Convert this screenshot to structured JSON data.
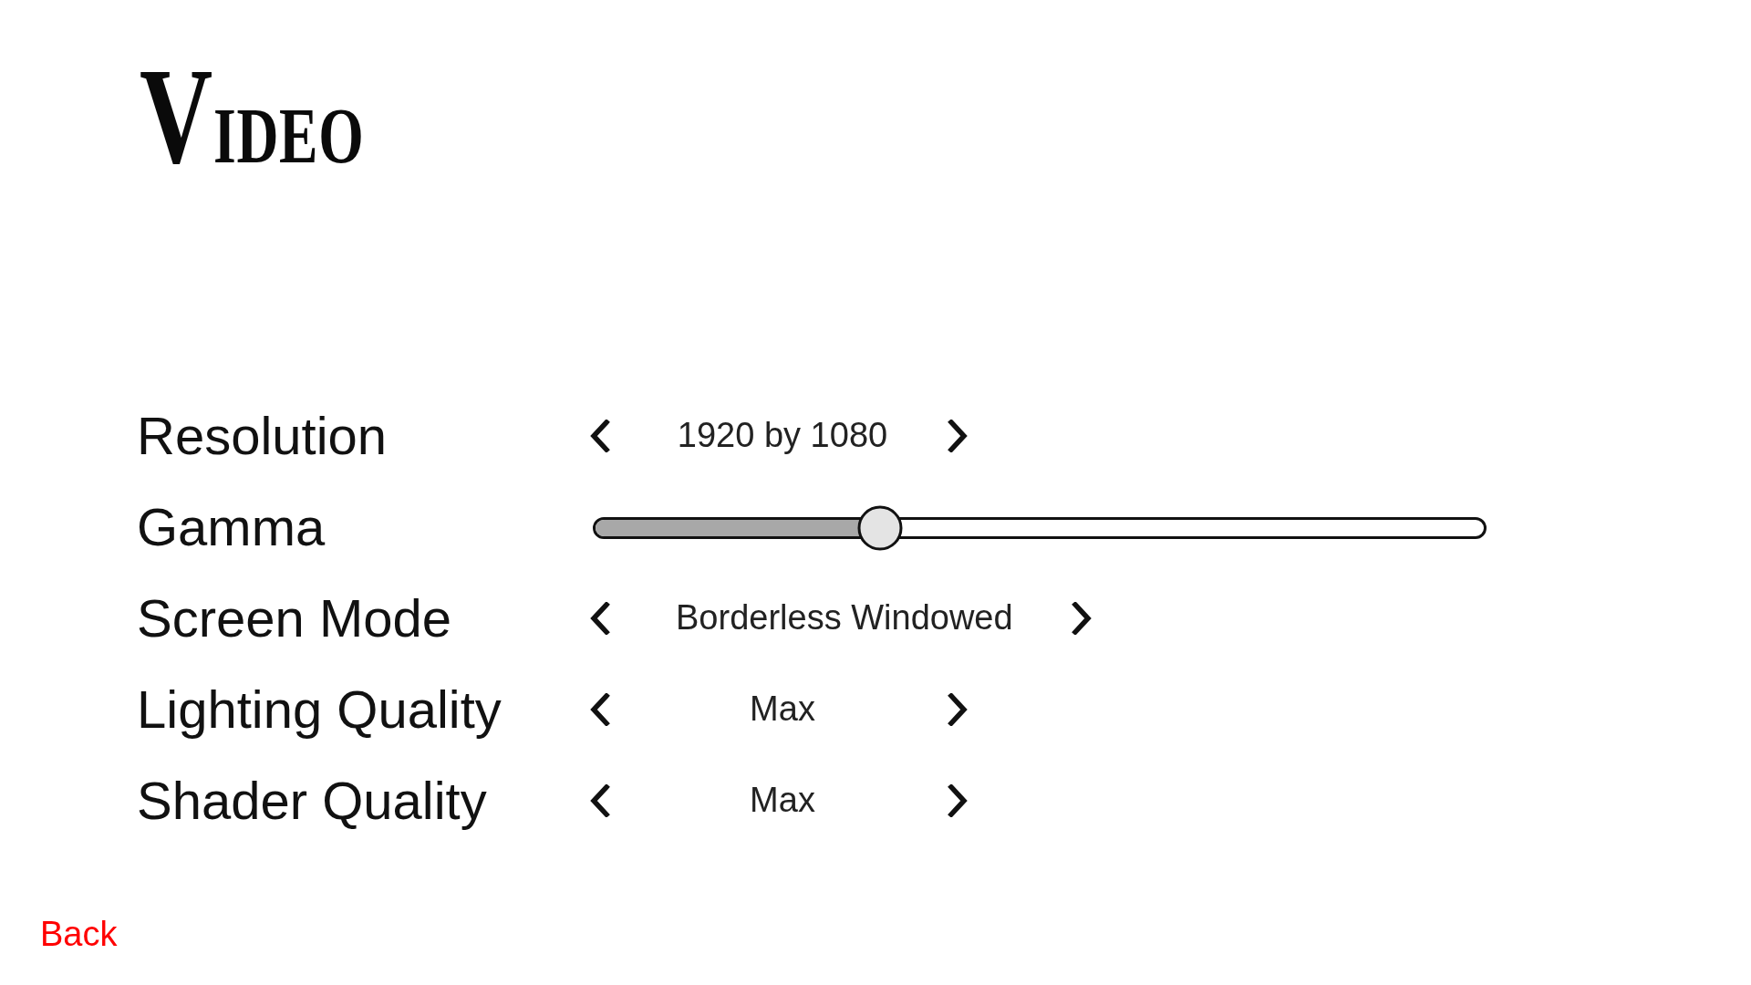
{
  "title": "VIDEO",
  "settings": [
    {
      "kind": "selector",
      "label": "Resolution",
      "value": "1920 by 1080"
    },
    {
      "kind": "slider",
      "label": "Gamma",
      "level": 0.32
    },
    {
      "kind": "selector",
      "label": "Screen Mode",
      "value": "Borderless Windowed"
    },
    {
      "kind": "selector",
      "label": "Lighting Quality",
      "value": "Max"
    },
    {
      "kind": "selector",
      "label": "Shader Quality",
      "value": "Max"
    }
  ],
  "back_link": "Back"
}
